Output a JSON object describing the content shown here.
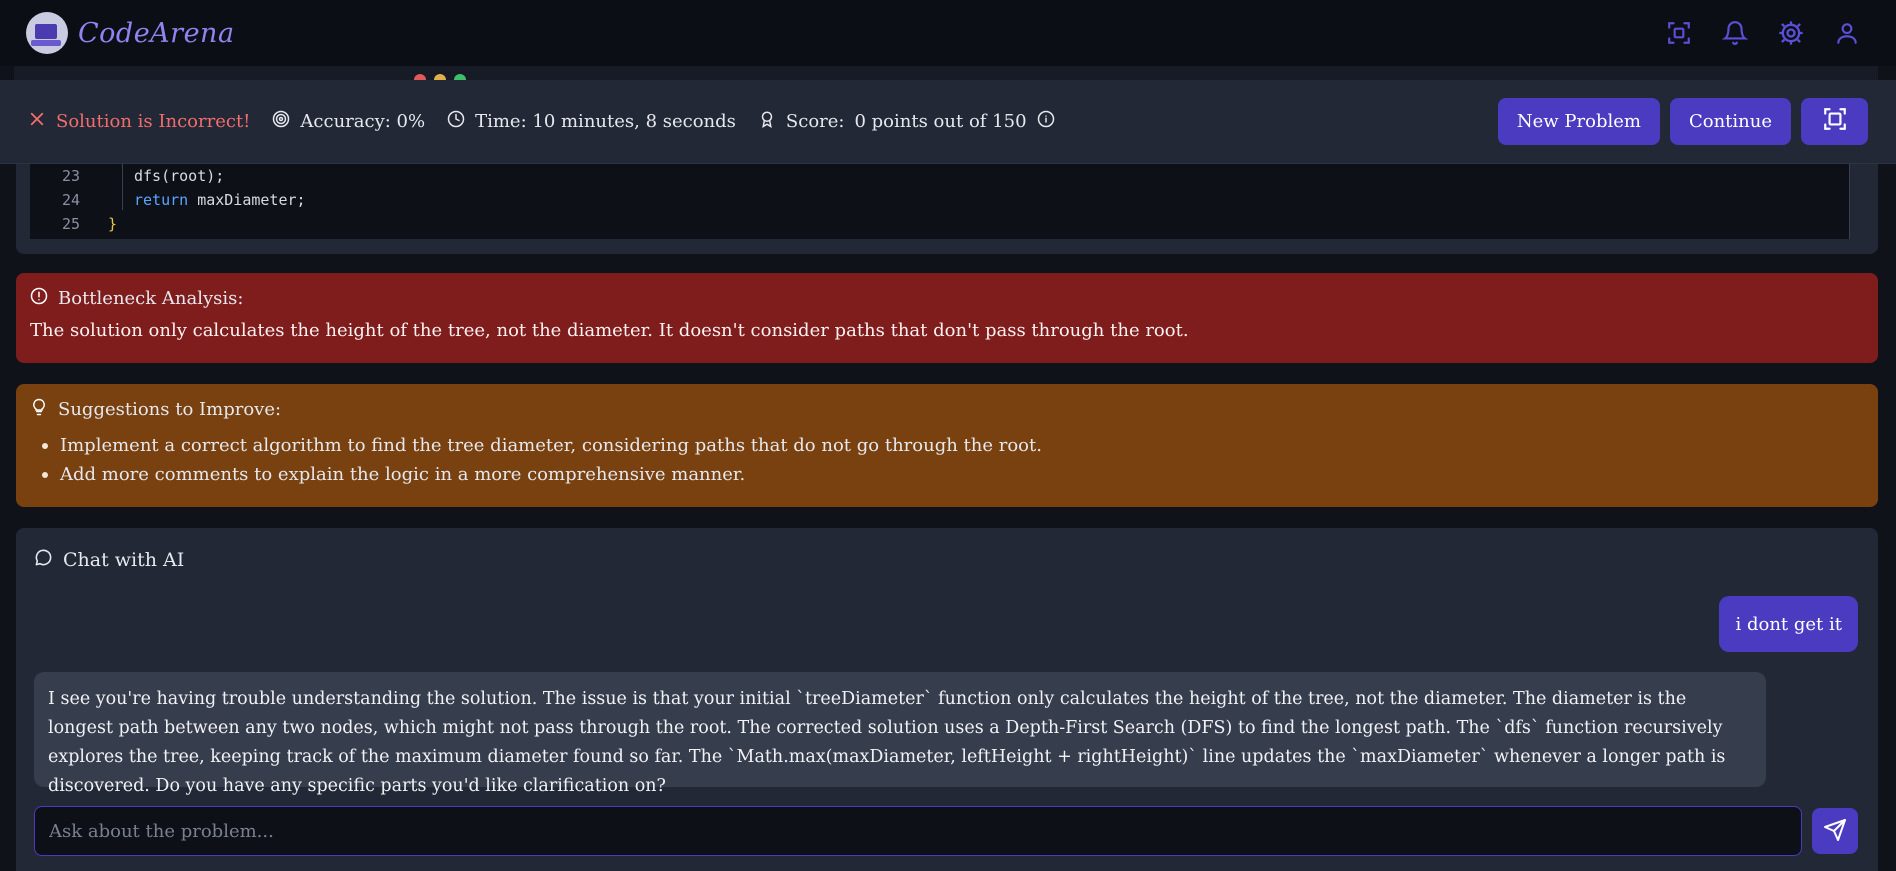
{
  "app": {
    "name": "CodeArena"
  },
  "colors": {
    "accent": "#4a3bc1",
    "error": "#f26d6d",
    "bottleneck_bg": "#7f1d1d",
    "suggest_bg": "#78410f"
  },
  "result": {
    "status": "Solution is Incorrect!",
    "accuracy": "Accuracy: 0%",
    "time": "Time: 10 minutes, 8 seconds",
    "score_label": "Score:",
    "score_value": "0 points out of 150",
    "new_problem_label": "New Problem",
    "continue_label": "Continue"
  },
  "code": {
    "lines": [
      {
        "num": "23",
        "text": "dfs(root);"
      },
      {
        "num": "24",
        "keyword": "return",
        "text": "maxDiameter;"
      },
      {
        "num": "25",
        "text": "}"
      }
    ]
  },
  "bottleneck": {
    "title": "Bottleneck Analysis:",
    "text": "The solution only calculates the height of the tree, not the diameter. It doesn't consider paths that don't pass through the root."
  },
  "suggestions": {
    "title": "Suggestions to Improve:",
    "items": [
      "Implement a correct algorithm to find the tree diameter, considering paths that do not go through the root.",
      "Add more comments to explain the logic in a more comprehensive manner."
    ]
  },
  "chat": {
    "title": "Chat with AI",
    "user_message": "i dont get it",
    "ai_message": "I see you're having trouble understanding the solution. The issue is that your initial `treeDiameter` function only calculates the height of the tree, not the diameter. The diameter is the longest path between any two nodes, which might not pass through the root. The corrected solution uses a Depth-First Search (DFS) to find the longest path. The `dfs` function recursively explores the tree, keeping track of the maximum diameter found so far. The `Math.max(maxDiameter, leftHeight + rightHeight)` line updates the `maxDiameter` whenever a longer path is discovered. Do you have any specific parts you'd like clarification on?",
    "input_placeholder": "Ask about the problem..."
  },
  "icons": [
    "fullscreen-scan-icon",
    "bell-icon",
    "gear-icon",
    "user-icon",
    "close-x-icon",
    "target-icon",
    "clock-icon",
    "award-icon",
    "info-icon",
    "alert-circle-icon",
    "lightbulb-icon",
    "chat-bubble-icon",
    "send-icon",
    "focus-frame-icon"
  ]
}
